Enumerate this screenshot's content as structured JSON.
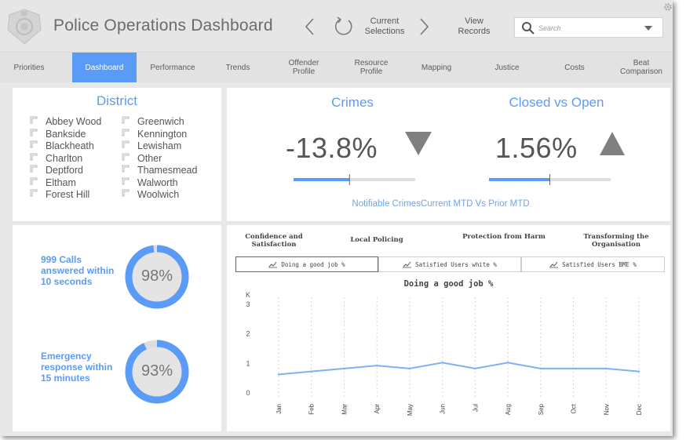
{
  "header": {
    "title": "Police Operations Dashboard",
    "current_selections": "Current Selections",
    "view_records": "View Records",
    "search_placeholder": "Search"
  },
  "tabs": [
    {
      "label": "Priorities"
    },
    {
      "label": "Dashboard",
      "active": true
    },
    {
      "label": "Performance"
    },
    {
      "label": "Trends"
    },
    {
      "label": "Offender Profile"
    },
    {
      "label": "Resource Profile"
    },
    {
      "label": "Mapping"
    },
    {
      "label": "Justice"
    },
    {
      "label": "Costs"
    },
    {
      "label": "Beat Comparison"
    }
  ],
  "district": {
    "title": "District",
    "items_col1": [
      "Abbey Wood",
      "Bankside",
      "Blackheath",
      "Charlton",
      "Deptford",
      "Eltham",
      "Forest Hill"
    ],
    "items_col2": [
      "Greenwich",
      "Kennington",
      "Lewisham",
      "Other",
      "Thamesmead",
      "Walworth",
      "Woolwich"
    ]
  },
  "crimes": {
    "title": "Crimes",
    "value": "-13.8%",
    "direction": "down",
    "progress": 0.46
  },
  "closed_open": {
    "title": "Closed vs Open",
    "value": "1.56%",
    "direction": "up",
    "progress": 0.5
  },
  "kpi_note": "Notifiable CrimesCurrent MTD Vs Prior MTD",
  "calls": {
    "label": "999 Calls answered within 10 seconds",
    "value": "98%",
    "fraction": 0.98
  },
  "emergency": {
    "label": "Emergency response within 15 minutes",
    "value": "93%",
    "fraction": 0.93
  },
  "categories": [
    "Confidence and Satisfaction",
    "Local Policing",
    "Protection from Harm",
    "Transforming the Organisation"
  ],
  "subtabs": [
    {
      "label": "Doing a good job %",
      "active": true
    },
    {
      "label": "Satisfied Users white %"
    },
    {
      "label": "Satisfied Users BME %"
    }
  ],
  "colors": {
    "accent": "#5b9bf8",
    "line": "#7fb0f5",
    "track": "#dddddd",
    "arrow": "#808080"
  },
  "chart_data": {
    "type": "line",
    "title": "Doing a good job %",
    "y_unit": "K",
    "categories": [
      "Jan",
      "Feb",
      "Mar",
      "Apr",
      "May",
      "Jun",
      "Jul",
      "Aug",
      "Sep",
      "Oct",
      "Nov",
      "Dec"
    ],
    "values": [
      0.6,
      0.7,
      0.8,
      0.9,
      0.8,
      1.0,
      0.8,
      1.0,
      0.8,
      0.8,
      0.8,
      0.7
    ],
    "ylim": [
      0,
      3
    ],
    "yticks": [
      "0",
      "1",
      "2",
      "3"
    ],
    "grid": "vertical dotted"
  }
}
